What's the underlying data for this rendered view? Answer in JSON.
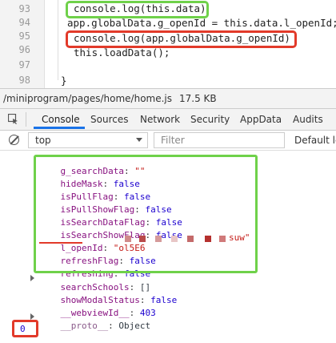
{
  "editor": {
    "lines": [
      {
        "no": "93",
        "text": "console.log(this.data)"
      },
      {
        "no": "94",
        "text": "app.globalData.g_openId = this.data.l_openId;"
      },
      {
        "no": "95",
        "text": "console.log(app.globalData.g_openId)"
      },
      {
        "no": "96",
        "text": "this.loadData();"
      },
      {
        "no": "97",
        "text": ""
      },
      {
        "no": "98",
        "text": "}"
      }
    ]
  },
  "statusbar": {
    "path": "/miniprogram/pages/home/home.js",
    "size": "17.5 KB"
  },
  "devtools": {
    "tabs": [
      "Console",
      "Sources",
      "Network",
      "Security",
      "AppData",
      "Audits"
    ],
    "active_tab": "Console",
    "context": "top",
    "filter_placeholder": "Filter",
    "levels_label": "Default le"
  },
  "console": {
    "props": [
      {
        "key": "g_searchData",
        "sep": ": ",
        "value": "\"\"",
        "type": "str"
      },
      {
        "key": "hideMask",
        "sep": ": ",
        "value": "false",
        "type": "bool"
      },
      {
        "key": "isPullFlag",
        "sep": ": ",
        "value": "false",
        "type": "bool"
      },
      {
        "key": "isPullShowFlag",
        "sep": ": ",
        "value": "false",
        "type": "bool"
      },
      {
        "key": "isSearchDataFlag",
        "sep": ": ",
        "value": "false",
        "type": "bool"
      },
      {
        "key": "isSearchShowFlag",
        "sep": ": ",
        "value": "false",
        "type": "bool"
      },
      {
        "key": "l_openId",
        "sep": ": ",
        "value": "\"ol5E6",
        "value_end": "suw\"",
        "type": "str"
      },
      {
        "key": "refreshFlag",
        "sep": ": ",
        "value": "false",
        "type": "bool"
      },
      {
        "key": "refreshing",
        "sep": ": ",
        "value": "false",
        "type": "bool"
      }
    ],
    "extra_props": [
      {
        "key": "searchSchools",
        "sep": ": ",
        "value": "[]",
        "type": "obj",
        "expandable": true
      },
      {
        "key": "showModalStatus",
        "sep": ": ",
        "value": "false",
        "type": "bool"
      },
      {
        "key": "__webviewId__",
        "sep": ": ",
        "value": "403",
        "type": "num"
      },
      {
        "key": "__proto__",
        "sep": ": ",
        "value": "Object",
        "type": "obj",
        "expandable": true,
        "grey": true
      }
    ],
    "result": "0"
  },
  "colors": {
    "highlight_green": "#6fd14a",
    "highlight_red": "#e23a2a",
    "tab_underline": "#1a73e8"
  }
}
